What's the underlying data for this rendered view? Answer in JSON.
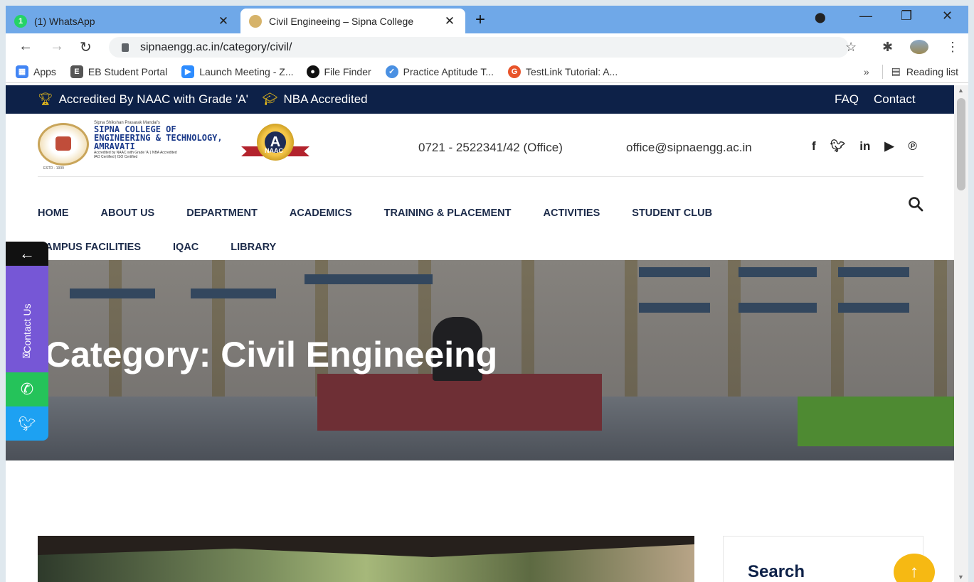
{
  "browser": {
    "tabs": [
      {
        "title": "(1) WhatsApp",
        "favicon_badge": "1",
        "favicon_color": "#25D366",
        "active": false
      },
      {
        "title": "Civil Engineeing – Sipna College",
        "favicon_color": "#d6b36a",
        "active": true
      }
    ],
    "url": "sipnaengg.ac.in/category/civil/",
    "bookmarks": [
      {
        "label": "Apps",
        "icon": "apps-grid-icon",
        "color": "#4285f4"
      },
      {
        "label": "EB Student Portal",
        "icon": "eb-icon",
        "color": "#555555"
      },
      {
        "label": "Launch Meeting - Z...",
        "icon": "zoom-icon",
        "color": "#2d8cff"
      },
      {
        "label": "File Finder",
        "icon": "github-icon",
        "color": "#111111"
      },
      {
        "label": "Practice Aptitude T...",
        "icon": "check-icon",
        "color": "#4a90e2"
      },
      {
        "label": "TestLink Tutorial: A...",
        "icon": "guru-icon",
        "color": "#e8542a"
      }
    ],
    "bookmarks_overflow": "»",
    "reading_list": "Reading list"
  },
  "topbar": {
    "accreditation": "Accredited By NAAC with Grade 'A'",
    "nba": "NBA Accredited",
    "faq": "FAQ",
    "contact": "Contact"
  },
  "brand": {
    "pre": "Sipna Shikshan Prasarak Mandal's",
    "line1": "SIPNA COLLEGE OF",
    "line2": "ENGINEERING & TECHNOLOGY,",
    "line3": "AMRAVATI",
    "accred1": "Accredited by NAAC with Grade 'A' | NBA Accredited",
    "accred2": "IAO Certified | ISO Certified",
    "estd": "ESTD - 1999",
    "naac_badge": "NAAC",
    "naac_grade": "A"
  },
  "contact": {
    "phone": "0721 - 2522341/42 (Office)",
    "email": "office@sipnaengg.ac.in"
  },
  "nav": {
    "row1": [
      "HOME",
      "ABOUT US",
      "DEPARTMENT",
      "ACADEMICS",
      "TRAINING & PLACEMENT",
      "ACTIVITIES",
      "STUDENT CLUB"
    ],
    "row2": [
      "CAMPUS FACILITIES",
      "IQAC",
      "LIBRARY"
    ]
  },
  "hero": {
    "title": "Category: Civil Engineeing"
  },
  "floating": {
    "contact_label": "Contact Us"
  },
  "sidebar": {
    "search_title": "Search"
  },
  "colors": {
    "topbar": "#0d2148",
    "accent": "#f6b913",
    "contact_float": "#7657d6",
    "whatsapp": "#25c35a",
    "twitter": "#1da1f2"
  }
}
